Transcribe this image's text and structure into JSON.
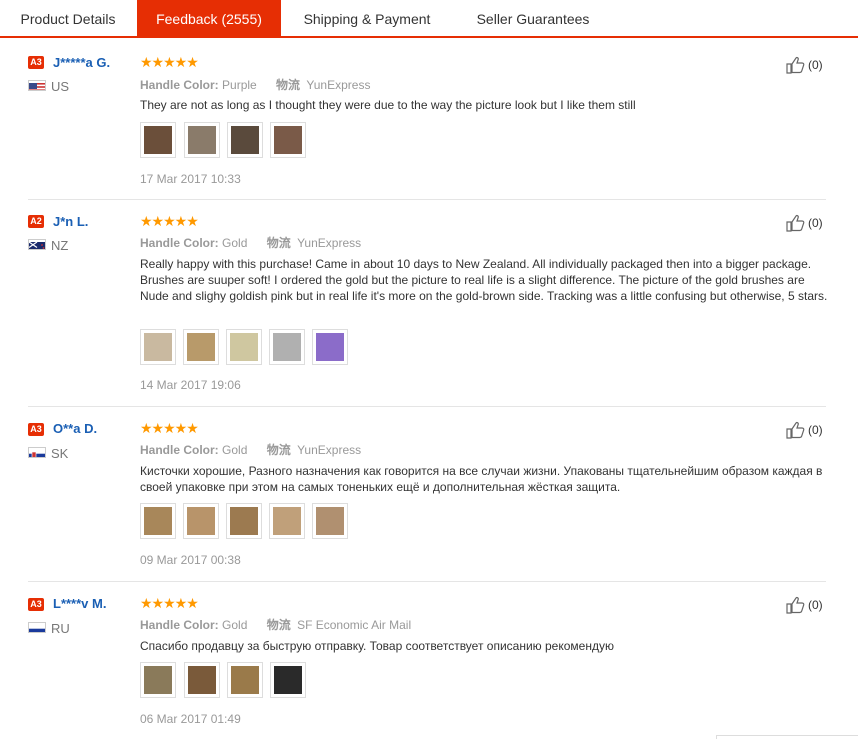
{
  "tabs": [
    {
      "label": "Product Details"
    },
    {
      "label": "Feedback (2555)"
    },
    {
      "label": "Shipping & Payment"
    },
    {
      "label": "Seller Guarantees"
    }
  ],
  "active_tab_color": "#e62e04",
  "stars_glyph": "★★★★★",
  "handle_color_label": "Handle Color:",
  "logistics_label": "物流",
  "reviews": [
    {
      "badge": "A3",
      "name": "J*****a G.",
      "country": "US",
      "handle_color": "Purple",
      "logistics": "YunExpress",
      "content": "They are not as long as I thought they were due to the way the picture look but I like them still",
      "date": "17 Mar 2017 10:33",
      "likes": "(0)",
      "thumb_colors": [
        "#6b4f3a",
        "#8a7b6a",
        "#5a4a3c",
        "#7a5a48"
      ]
    },
    {
      "badge": "A2",
      "name": "J*n L.",
      "country": "NZ",
      "handle_color": "Gold",
      "logistics": "YunExpress",
      "content": "Really happy with this purchase! Came in about 10 days to New Zealand. All individually packaged then into a bigger package. Brushes are suuper soft! I ordered the gold but the picture to real life is a slight difference. The picture of the gold brushes are Nude and slighy goldish pink but in real life it's more on the gold-brown side. Tracking was a little confusing but otherwise, 5 stars.",
      "date": "14 Mar 2017 19:06",
      "likes": "(0)",
      "thumb_colors": [
        "#c9b9a0",
        "#b89a6a",
        "#cfc7a0",
        "#b0b0b0",
        "#8b6cc9"
      ]
    },
    {
      "badge": "A3",
      "name": "O**a D.",
      "country": "SK",
      "handle_color": "Gold",
      "logistics": "YunExpress",
      "content": "Кисточки хорошие, Разного назначения как говорится на все случаи жизни. Упакованы тщательнейшим образом каждая в своей упаковке при этом на самых тоненьких ещё и дополнительная жёсткая защита.",
      "date": "09 Mar 2017 00:38",
      "likes": "(0)",
      "thumb_colors": [
        "#a8875a",
        "#b8946a",
        "#9c7a50",
        "#c0a07a",
        "#b09070"
      ]
    },
    {
      "badge": "A3",
      "name": "L****v M.",
      "country": "RU",
      "handle_color": "Gold",
      "logistics": "SF Economic Air Mail",
      "content": "Спасибо продавцу за быструю отправку. Товар соответствует описанию рекомендую",
      "date": "06 Mar 2017 01:49",
      "likes": "(0)",
      "thumb_colors": [
        "#8a7a5a",
        "#7a5a3a",
        "#9a7a4a",
        "#2a2a2a"
      ]
    }
  ]
}
